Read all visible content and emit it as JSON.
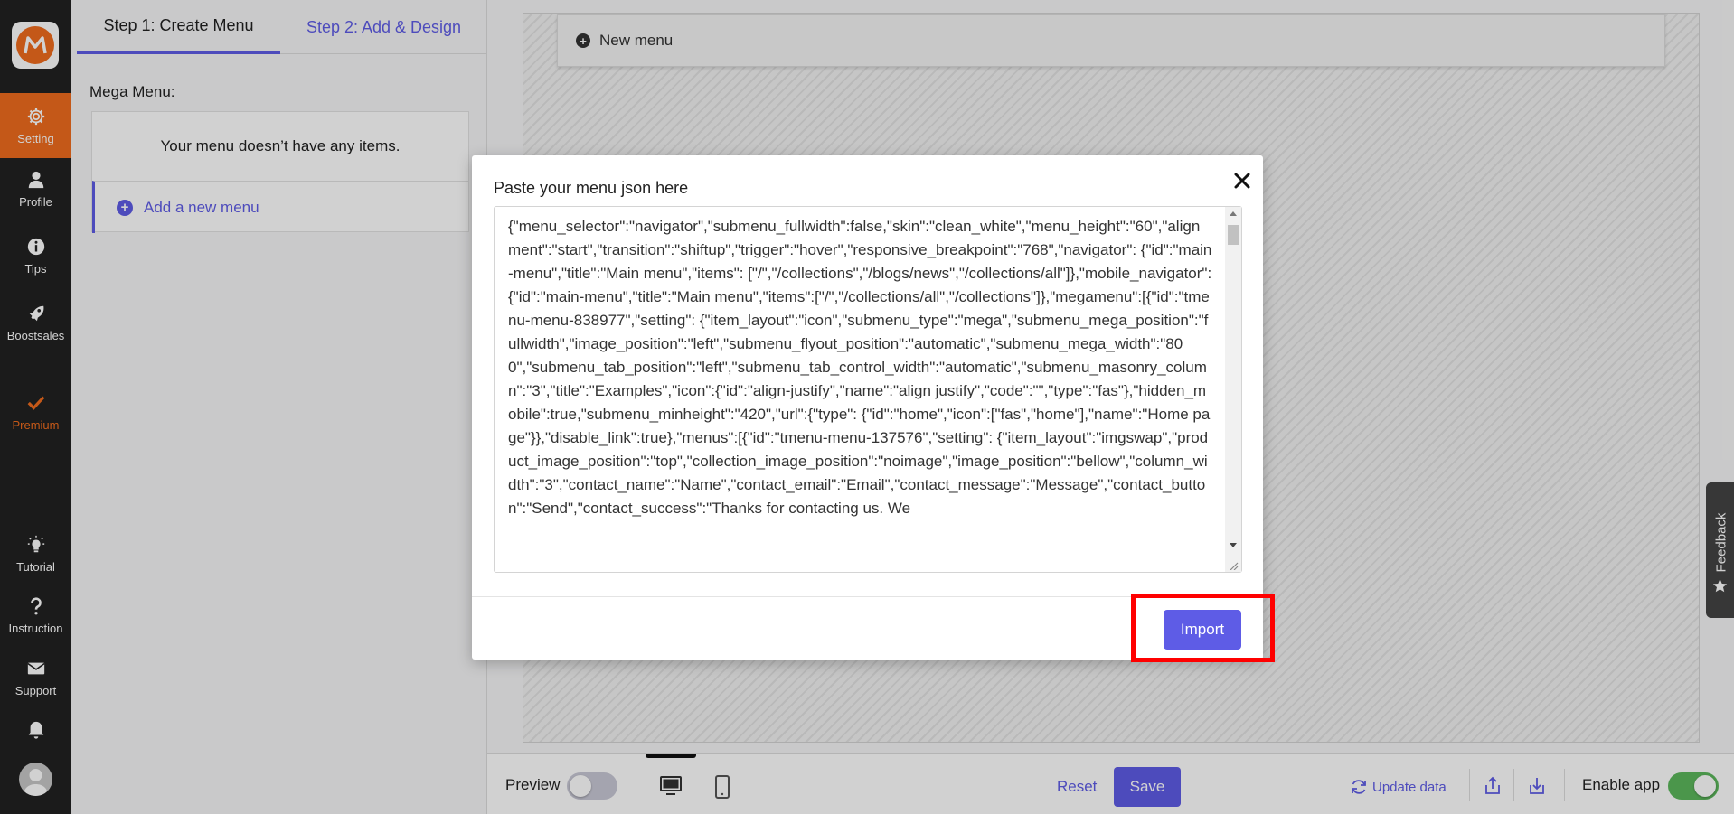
{
  "sidebar": {
    "logo_alt": "M",
    "items": [
      {
        "label": "Setting",
        "icon": "gear-icon"
      },
      {
        "label": "Profile",
        "icon": "user-icon"
      },
      {
        "label": "Tips",
        "icon": "info-icon"
      },
      {
        "label": "Boostsales",
        "icon": "rocket-icon"
      },
      {
        "label": "Premium",
        "icon": "check-icon"
      },
      {
        "label": "Tutorial",
        "icon": "lightbulb-icon"
      },
      {
        "label": "Instruction",
        "icon": "question-icon"
      },
      {
        "label": "Support",
        "icon": "envelope-icon"
      }
    ]
  },
  "tabs": {
    "step1": "Step 1: Create Menu",
    "step2": "Step 2: Add & Design"
  },
  "panel": {
    "mega_menu_label": "Mega Menu:",
    "empty_message": "Your menu doesn’t have any items.",
    "add_menu_label": "Add a new menu"
  },
  "preview": {
    "new_menu_label": "New menu"
  },
  "bottom_bar": {
    "preview_label": "Preview",
    "reset_label": "Reset",
    "save_label": "Save",
    "update_data_label": "Update data",
    "enable_app_label": "Enable app"
  },
  "modal": {
    "title": "Paste your menu json here",
    "json_value": "{\"menu_selector\":\"navigator\",\"submenu_fullwidth\":false,\"skin\":\"clean_white\",\"menu_height\":\"60\",\"alignment\":\"start\",\"transition\":\"shiftup\",\"trigger\":\"hover\",\"responsive_breakpoint\":\"768\",\"navigator\": {\"id\":\"main-menu\",\"title\":\"Main menu\",\"items\": [\"/\",\"/collections\",\"/blogs/news\",\"/collections/all\"]},\"mobile_navigator\":{\"id\":\"main-menu\",\"title\":\"Main menu\",\"items\":[\"/\",\"/collections/all\",\"/collections\"]},\"megamenu\":[{\"id\":\"tmenu-menu-838977\",\"setting\": {\"item_layout\":\"icon\",\"submenu_type\":\"mega\",\"submenu_mega_position\":\"fullwidth\",\"image_position\":\"left\",\"submenu_flyout_position\":\"automatic\",\"submenu_mega_width\":\"800\",\"submenu_tab_position\":\"left\",\"submenu_tab_control_width\":\"automatic\",\"submenu_masonry_column\":\"3\",\"title\":\"Examples\",\"icon\":{\"id\":\"align-justify\",\"name\":\"align justify\",\"code\":\"\",\"type\":\"fas\"},\"hidden_mobile\":true,\"submenu_minheight\":\"420\",\"url\":{\"type\": {\"id\":\"home\",\"icon\":[\"fas\",\"home\"],\"name\":\"Home page\"}},\"disable_link\":true},\"menus\":[{\"id\":\"tmenu-menu-137576\",\"setting\": {\"item_layout\":\"imgswap\",\"product_image_position\":\"top\",\"collection_image_position\":\"noimage\",\"image_position\":\"bellow\",\"column_width\":\"3\",\"contact_name\":\"Name\",\"contact_email\":\"Email\",\"contact_message\":\"Message\",\"contact_button\":\"Send\",\"contact_success\":\"Thanks for contacting us. We",
    "import_label": "Import"
  },
  "feedback_label": "Feedback",
  "colors": {
    "accent": "#5e5ce6",
    "brand_orange": "#ef6c1e",
    "sidebar_bg": "#222222",
    "highlight": "#ff0000",
    "toggle_on": "#5cb85c"
  }
}
